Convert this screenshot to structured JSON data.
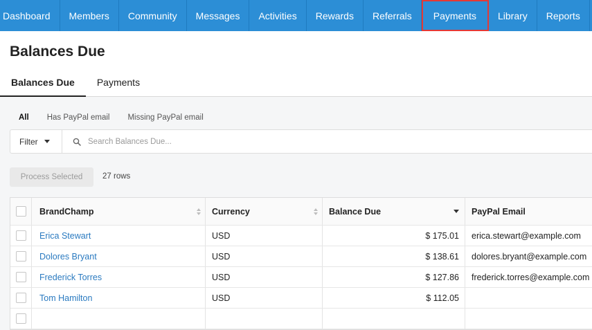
{
  "nav": {
    "items": [
      {
        "label": "Dashboard",
        "active": false
      },
      {
        "label": "Members",
        "active": false
      },
      {
        "label": "Community",
        "active": false
      },
      {
        "label": "Messages",
        "active": false
      },
      {
        "label": "Activities",
        "active": false
      },
      {
        "label": "Rewards",
        "active": false
      },
      {
        "label": "Referrals",
        "active": false
      },
      {
        "label": "Payments",
        "active": true
      },
      {
        "label": "Library",
        "active": false
      },
      {
        "label": "Reports",
        "active": false
      }
    ],
    "bar_color": "#2c8ed6",
    "highlight_color": "#e53935"
  },
  "page": {
    "title": "Balances Due",
    "tabs": [
      {
        "label": "Balances Due",
        "active": true
      },
      {
        "label": "Payments",
        "active": false
      }
    ]
  },
  "subfilters": [
    {
      "label": "All",
      "active": true
    },
    {
      "label": "Has PayPal email",
      "active": false
    },
    {
      "label": "Missing PayPal email",
      "active": false
    }
  ],
  "search": {
    "filter_label": "Filter",
    "placeholder": "Search Balances Due...",
    "value": ""
  },
  "actions": {
    "process_label": "Process Selected",
    "rows_count": "27 rows"
  },
  "table": {
    "columns": [
      "BrandChamp",
      "Currency",
      "Balance Due",
      "PayPal Email"
    ],
    "rows": [
      {
        "name": "Erica Stewart",
        "currency": "USD",
        "balance": "$ 175.01",
        "email": "erica.stewart@example.com"
      },
      {
        "name": "Dolores Bryant",
        "currency": "USD",
        "balance": "$ 138.61",
        "email": "dolores.bryant@example.com"
      },
      {
        "name": "Frederick Torres",
        "currency": "USD",
        "balance": "$ 127.86",
        "email": "frederick.torres@example.com"
      },
      {
        "name": "Tom Hamilton",
        "currency": "USD",
        "balance": "$ 112.05",
        "email": ""
      }
    ]
  }
}
